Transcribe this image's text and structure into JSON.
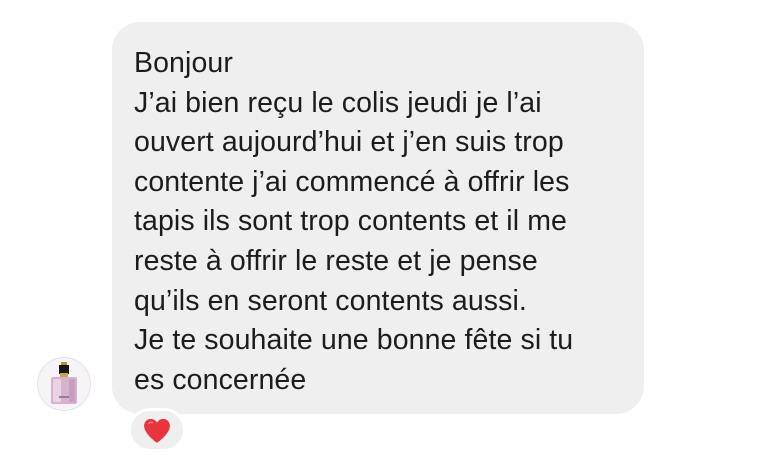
{
  "message": {
    "lines": [
      "Bonjour",
      "J’ai bien reçu le colis jeudi je l’ai",
      "ouvert aujourd’hui et j’en suis trop",
      "contente j’ai commencé à offrir les",
      "tapis ils sont trop contents et il me",
      "reste à offrir le reste et je pense",
      "qu’ils en seront contents aussi.",
      "Je te souhaite une bonne fête si tu",
      "es concernée"
    ]
  },
  "sender": {
    "avatar_icon": "perfume-bottle-icon"
  },
  "reaction": {
    "icon": "red-heart-icon",
    "color": "#e8343c"
  },
  "colors": {
    "bubble_background": "#efefef",
    "text": "#1c1c1c",
    "page_background": "#ffffff"
  }
}
